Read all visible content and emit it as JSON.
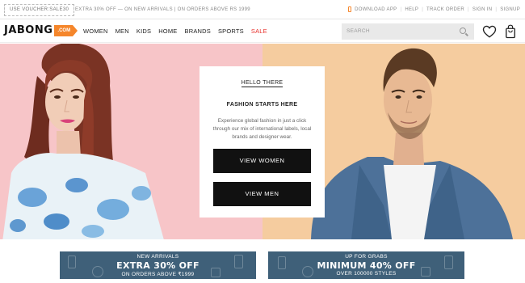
{
  "topbar": {
    "voucher": "USE VOUCHER:SALE30",
    "promo": "EXTRA 30% OFF — ON NEW ARRIVALS | ON ORDERS ABOVE RS 1999",
    "links": [
      "DOWNLOAD APP",
      "HELP",
      "TRACK ORDER",
      "SIGN IN",
      "SIGNUP"
    ]
  },
  "header": {
    "logo_text": "JABONG",
    "logo_tag": ".COM",
    "nav": [
      "WOMEN",
      "MEN",
      "KIDS",
      "HOME",
      "BRANDS",
      "SPORTS",
      "SALE"
    ],
    "search_placeholder": "SEARCH"
  },
  "hero": {
    "hello": "HELLO THERE",
    "title": "FASHION STARTS HERE",
    "description": "Experience global fashion in just a click through our mix of international labels, local brands and designer wear.",
    "btn_women": "VIEW WOMEN",
    "btn_men": "VIEW MEN"
  },
  "banners": [
    {
      "line1": "NEW ARRIVALS",
      "line2": "EXTRA 30% OFF",
      "line3": "ON ORDERS ABOVE ₹1999"
    },
    {
      "line1": "UP FOR GRABS",
      "line2": "MINIMUM 40% OFF",
      "line3": "OVER 100000 STYLES"
    }
  ],
  "colors": {
    "brand_orange": "#f5862b",
    "sale_red": "#e8312c",
    "hero_left_bg": "#f7c5c8",
    "hero_right_bg": "#f5cc9f",
    "banner_bg": "#3f6079"
  },
  "icons": [
    "phone-icon",
    "search-icon",
    "heart-icon",
    "bag-icon"
  ]
}
